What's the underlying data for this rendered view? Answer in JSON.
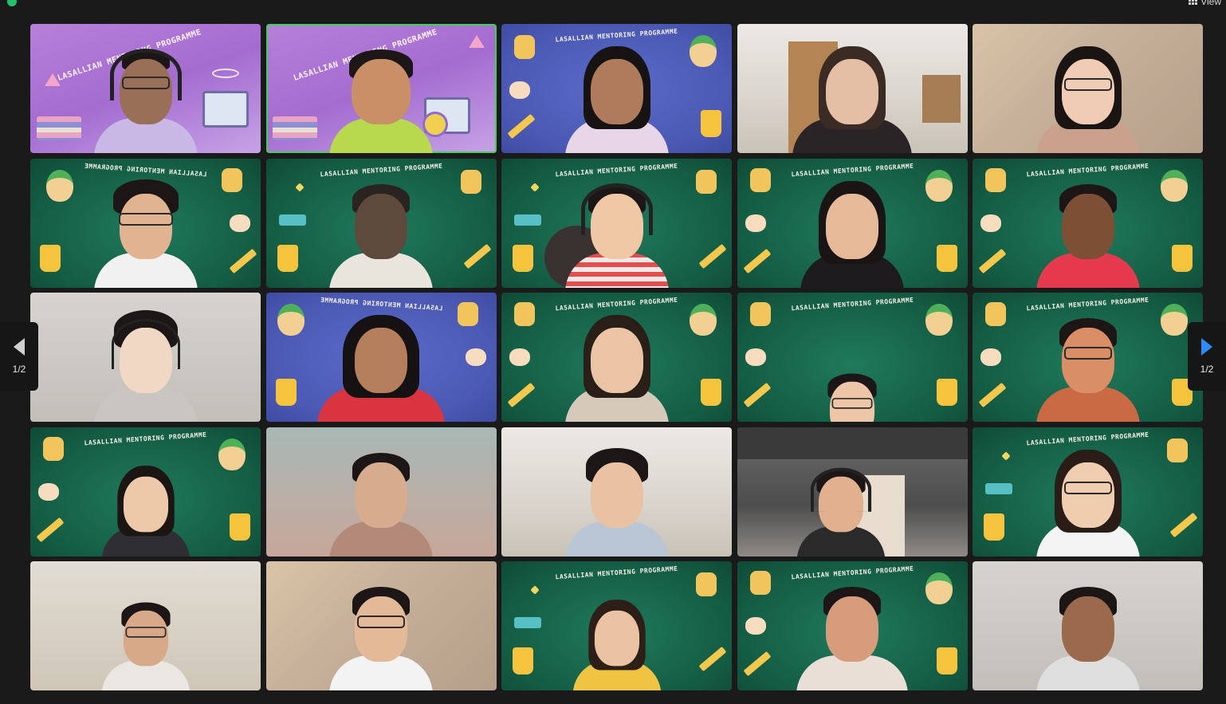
{
  "toolbar": {
    "view_label": "View"
  },
  "pager": {
    "left_page": "1/2",
    "right_page": "1/2"
  },
  "banner_text": "LASALLIAN MENTORING PROGRAMME",
  "colors": {
    "active_speaker": "#3ed05b",
    "next_arrow": "#2d8cff",
    "background": "#1a1a1a"
  },
  "tiles": [
    {
      "id": 1,
      "bg": "purple",
      "banner": "big"
    },
    {
      "id": 2,
      "bg": "purple",
      "banner": "big",
      "active": true
    },
    {
      "id": 3,
      "bg": "blue",
      "banner": "normal"
    },
    {
      "id": 4,
      "bg": "room"
    },
    {
      "id": 5,
      "bg": "room"
    },
    {
      "id": 6,
      "bg": "green",
      "banner": "mirror"
    },
    {
      "id": 7,
      "bg": "green",
      "banner": "normal"
    },
    {
      "id": 8,
      "bg": "green",
      "banner": "normal"
    },
    {
      "id": 9,
      "bg": "green",
      "banner": "normal"
    },
    {
      "id": 10,
      "bg": "green",
      "banner": "normal"
    },
    {
      "id": 11,
      "bg": "room"
    },
    {
      "id": 12,
      "bg": "blue",
      "banner": "mirror"
    },
    {
      "id": 13,
      "bg": "green",
      "banner": "normal"
    },
    {
      "id": 14,
      "bg": "green",
      "banner": "normal"
    },
    {
      "id": 15,
      "bg": "green",
      "banner": "normal"
    },
    {
      "id": 16,
      "bg": "green",
      "banner": "normal"
    },
    {
      "id": 17,
      "bg": "room"
    },
    {
      "id": 18,
      "bg": "room"
    },
    {
      "id": 19,
      "bg": "room"
    },
    {
      "id": 20,
      "bg": "green",
      "banner": "normal"
    },
    {
      "id": 21,
      "bg": "room"
    },
    {
      "id": 22,
      "bg": "room"
    },
    {
      "id": 23,
      "bg": "green",
      "banner": "normal"
    },
    {
      "id": 24,
      "bg": "green",
      "banner": "normal"
    },
    {
      "id": 25,
      "bg": "room"
    }
  ]
}
